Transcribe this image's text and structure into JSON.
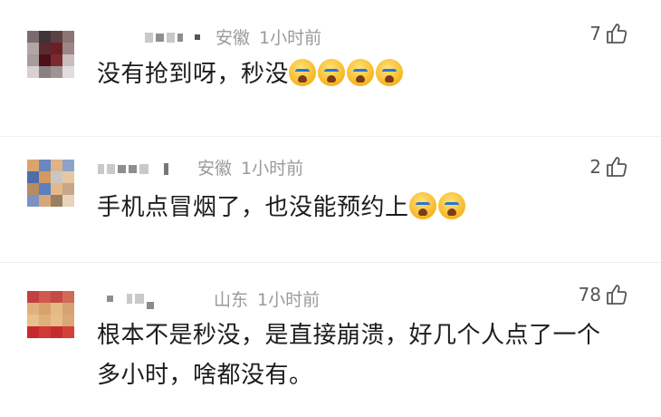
{
  "comments": [
    {
      "location": "安徽",
      "time": "1小时前",
      "text": "没有抢到呀，秒没",
      "emoji_count": 4,
      "likes": "7",
      "avatar_colors": [
        "#7a6c6e",
        "#3f3436",
        "#5d4244",
        "#8a7474",
        "#b4a6a6",
        "#5a2a30",
        "#6b1f24",
        "#9d8686",
        "#a89b9c",
        "#4b1018",
        "#7d2a2e",
        "#c8bcbc",
        "#d9d1d1",
        "#8c7f80",
        "#a09394",
        "#e2dcdc"
      ]
    },
    {
      "location": "安徽",
      "time": "1小时前",
      "text": "手机点冒烟了，也没能预约上",
      "emoji_count": 2,
      "likes": "2",
      "avatar_colors": [
        "#d9a56e",
        "#6a88c0",
        "#e0b488",
        "#8da3cc",
        "#4e6ea8",
        "#d4995e",
        "#c9c6c3",
        "#e6c7a2",
        "#b98b63",
        "#5a7fbf",
        "#e4b98a",
        "#c7a689",
        "#7c93c2",
        "#d6a77a",
        "#9c7e63",
        "#e9d3bb"
      ]
    },
    {
      "location": "山东",
      "time": "1小时前",
      "text": "根本不是秒没，是直接崩溃，好几个人点了一个多小时，啥都没有。",
      "emoji_count": 0,
      "likes": "78",
      "avatar_colors": [
        "#c4403f",
        "#cf5a4e",
        "#c44a45",
        "#d16a58",
        "#e2b07c",
        "#d9a26c",
        "#e4ba84",
        "#d8a172",
        "#e8c08c",
        "#ddb07a",
        "#e6bd86",
        "#d9a877",
        "#c7282d",
        "#cf3a36",
        "#c62c2f",
        "#d34038"
      ]
    }
  ]
}
